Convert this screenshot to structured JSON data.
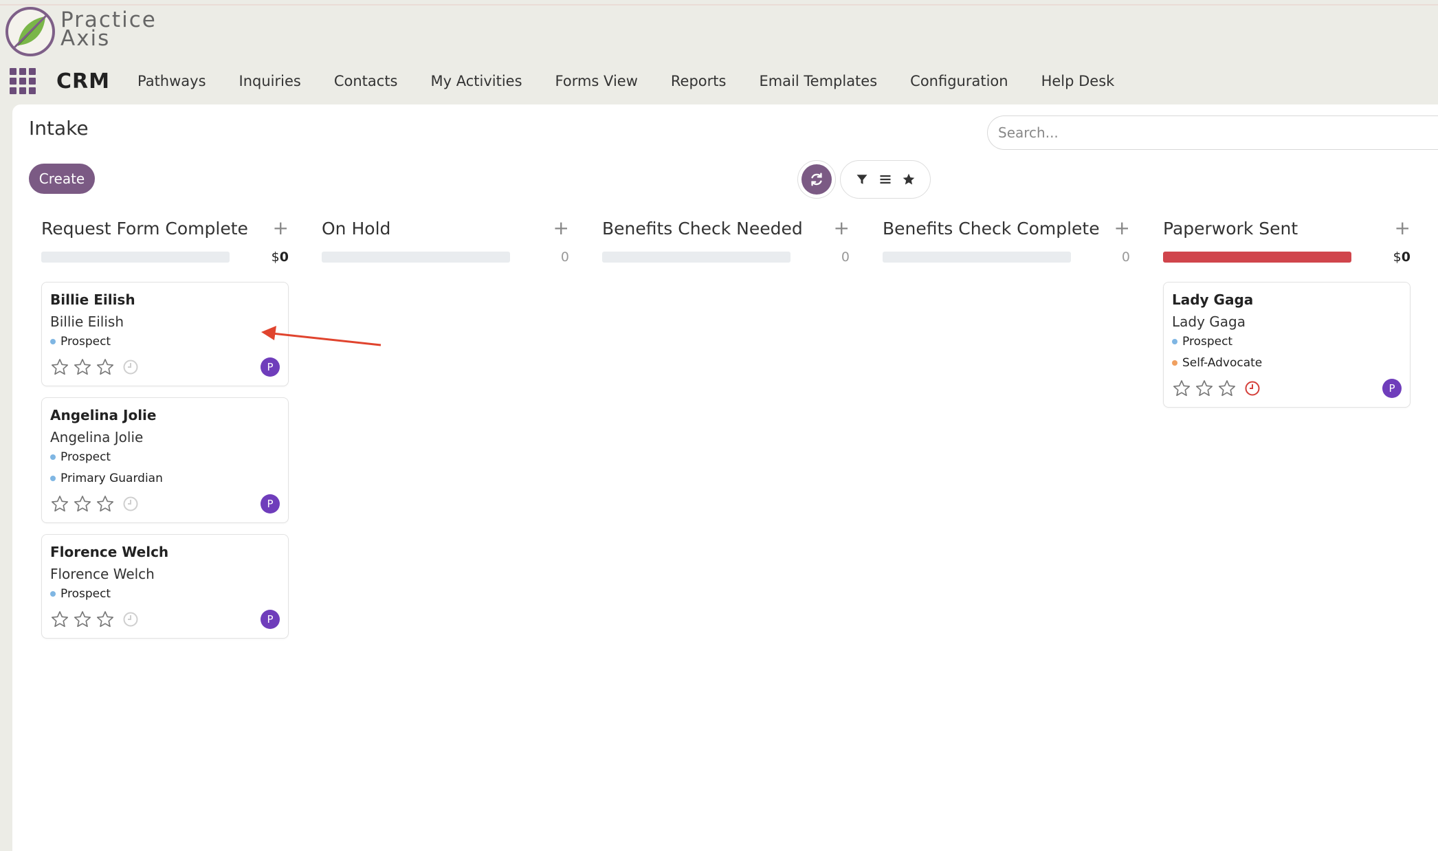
{
  "brand": {
    "line1": "Practice",
    "line2": "Axis"
  },
  "nav": {
    "app": "CRM",
    "items": [
      "Pathways",
      "Inquiries",
      "Contacts",
      "My Activities",
      "Forms View",
      "Reports",
      "Email Templates",
      "Configuration",
      "Help Desk"
    ]
  },
  "page": {
    "title": "Intake",
    "create_label": "Create",
    "search_placeholder": "Search..."
  },
  "icons": {
    "apps": "apps-grid-icon",
    "refresh": "refresh-icon",
    "filter": "filter-icon",
    "group_by": "group-by-icon",
    "favorites": "star-icon",
    "add": "plus-icon",
    "rating": "star-outline-icon",
    "activity": "clock-icon",
    "arrow": "arrow-annotation"
  },
  "colors": {
    "accent": "#7b5a84",
    "avatar": "#6f3dbb",
    "danger": "#d0454c",
    "tag_blue": "#7fb6e3",
    "tag_orange": "#f0a060"
  },
  "columns": [
    {
      "title": "Request Form Complete",
      "add": "+",
      "progress_fraction": 0,
      "sum_prefix": "$",
      "sum_value": "0",
      "cards": [
        {
          "title": "Billie Eilish",
          "subtitle": "Billie Eilish",
          "tags": [
            {
              "label": "Prospect",
              "color": "#7fb6e3"
            }
          ],
          "avatar": "P",
          "activity_overdue": false
        },
        {
          "title": "Angelina Jolie",
          "subtitle": "Angelina Jolie",
          "tags": [
            {
              "label": "Prospect",
              "color": "#7fb6e3"
            },
            {
              "label": "Primary Guardian",
              "color": "#7fb6e3"
            }
          ],
          "avatar": "P",
          "activity_overdue": false
        },
        {
          "title": "Florence Welch",
          "subtitle": "Florence Welch",
          "tags": [
            {
              "label": "Prospect",
              "color": "#7fb6e3"
            }
          ],
          "avatar": "P",
          "activity_overdue": false
        }
      ]
    },
    {
      "title": "On Hold",
      "add": "+",
      "progress_fraction": 0,
      "count": "0",
      "cards": []
    },
    {
      "title": "Benefits Check Needed",
      "add": "+",
      "progress_fraction": 0,
      "count": "0",
      "cards": []
    },
    {
      "title": "Benefits Check Complete",
      "add": "+",
      "progress_fraction": 0,
      "count": "0",
      "cards": []
    },
    {
      "title": "Paperwork Sent",
      "add": "+",
      "progress_fraction": 1,
      "sum_prefix": "$",
      "sum_value": "0",
      "cards": [
        {
          "title": "Lady Gaga",
          "subtitle": "Lady Gaga",
          "tags": [
            {
              "label": "Prospect",
              "color": "#7fb6e3"
            },
            {
              "label": "Self-Advocate",
              "color": "#f0a060"
            }
          ],
          "avatar": "P",
          "activity_overdue": true
        }
      ]
    }
  ]
}
